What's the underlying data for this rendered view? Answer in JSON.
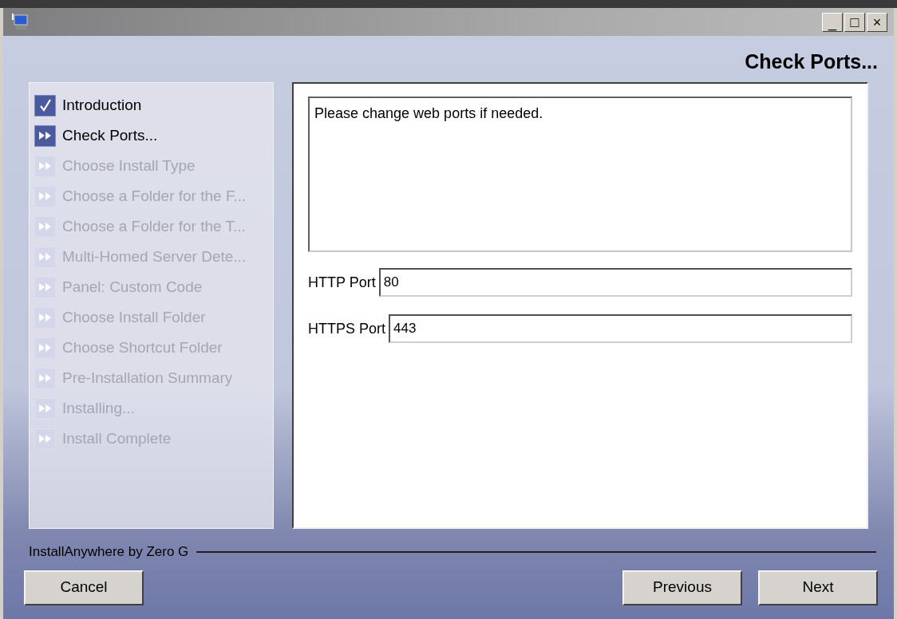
{
  "window": {
    "title_buttons": [
      "_",
      "□",
      "×"
    ]
  },
  "header": "Check Ports...",
  "steps": [
    {
      "label": "Introduction",
      "kind": "done"
    },
    {
      "label": "Check Ports...",
      "kind": "current"
    },
    {
      "label": "Choose Install Type",
      "kind": "pending"
    },
    {
      "label": "Choose a Folder for the F...",
      "kind": "pending"
    },
    {
      "label": "Choose a Folder for the T...",
      "kind": "pending"
    },
    {
      "label": "Multi-Homed Server Dete...",
      "kind": "pending"
    },
    {
      "label": "Panel: Custom Code",
      "kind": "pending"
    },
    {
      "label": "Choose Install Folder",
      "kind": "pending"
    },
    {
      "label": "Choose Shortcut Folder",
      "kind": "pending"
    },
    {
      "label": "Pre-Installation Summary",
      "kind": "pending"
    },
    {
      "label": "Installing...",
      "kind": "pending"
    },
    {
      "label": "Install Complete",
      "kind": "pending"
    }
  ],
  "message": "Please change web ports if needed.",
  "fields": [
    {
      "label": "HTTP Port",
      "value": "80"
    },
    {
      "label": "HTTPS Port",
      "value": "443"
    }
  ],
  "brand": "InstallAnywhere by Zero G",
  "buttons": {
    "cancel": "Cancel",
    "previous": "Previous",
    "next": "Next"
  }
}
